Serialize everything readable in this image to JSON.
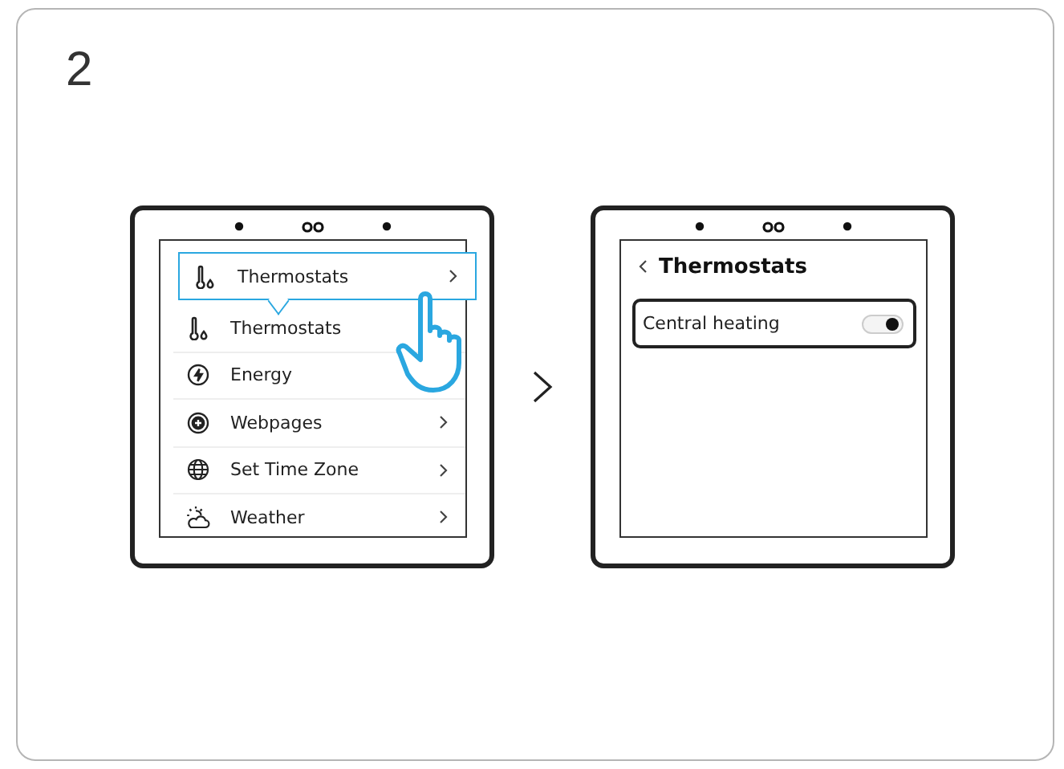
{
  "step": "2",
  "devices": [
    {
      "kind": "list",
      "callout": {
        "label": "Thermostats",
        "kind": "thermostat",
        "chevron": true
      },
      "items": [
        {
          "label": "Thermostats",
          "kind": "thermostat"
        },
        {
          "label": "Energy",
          "kind": "energy"
        },
        {
          "label": "Webpages",
          "kind": "webpages",
          "chevron": true
        },
        {
          "label": "Set Time Zone",
          "kind": "globe",
          "chevron": true
        },
        {
          "label": "Weather",
          "kind": "weather",
          "chevron": true
        }
      ]
    },
    {
      "kind": "detail",
      "back": true,
      "title": "Thermostats",
      "rows": [
        {
          "label": "Central heating",
          "on": true
        }
      ]
    }
  ]
}
